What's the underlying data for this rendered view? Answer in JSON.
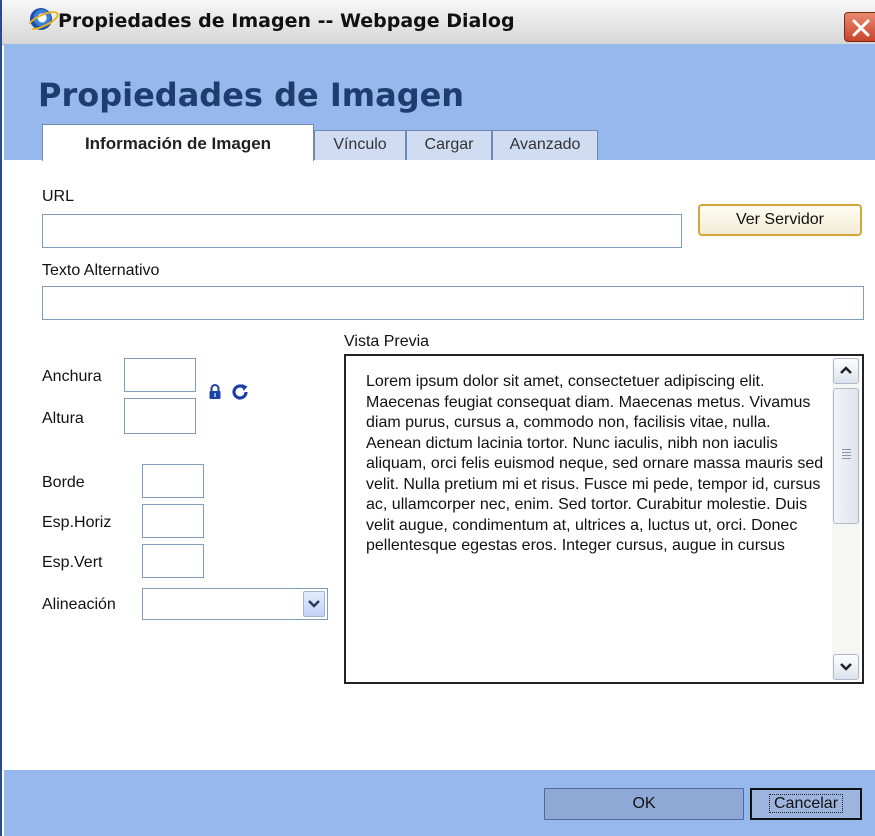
{
  "window": {
    "title": "Propiedades de Imagen -- Webpage Dialog"
  },
  "dialog": {
    "title": "Propiedades de Imagen",
    "tabs": [
      {
        "label": "Información de Imagen",
        "active": true
      },
      {
        "label": "Vínculo",
        "active": false
      },
      {
        "label": "Cargar",
        "active": false
      },
      {
        "label": "Avanzado",
        "active": false
      }
    ]
  },
  "form": {
    "url_label": "URL",
    "url_value": "",
    "browse_button": "Ver Servidor",
    "alt_label": "Texto Alternativo",
    "alt_value": "",
    "width_label": "Anchura",
    "width_value": "",
    "height_label": "Altura",
    "height_value": "",
    "border_label": "Borde",
    "border_value": "",
    "hspace_label": "Esp.Horiz",
    "hspace_value": "",
    "vspace_label": "Esp.Vert",
    "vspace_value": "",
    "align_label": "Alineación",
    "align_value": ""
  },
  "preview": {
    "label": "Vista Previa",
    "text": "Lorem ipsum dolor sit amet, consectetuer adipiscing elit. Maecenas feugiat consequat diam. Maecenas metus. Vivamus diam purus, cursus a, commodo non, facilisis vitae, nulla. Aenean dictum lacinia tortor. Nunc iaculis, nibh non iaculis aliquam, orci felis euismod neque, sed ornare massa mauris sed velit. Nulla pretium mi et risus. Fusce mi pede, tempor id, cursus ac, ullamcorper nec, enim. Sed tortor. Curabitur molestie. Duis velit augue, condimentum at, ultrices a, luctus ut, orci. Donec pellentesque egestas eros. Integer cursus, augue in cursus"
  },
  "footer": {
    "ok_label": "OK",
    "cancel_label": "Cancelar"
  },
  "icons": {
    "app": "ie-icon",
    "close": "close-icon",
    "lock": "lock-icon",
    "reset": "reset-size-icon",
    "dropdown": "chevron-down-icon"
  },
  "colors": {
    "header_bg": "#96b8ec",
    "title_text": "#1f3c6e",
    "close_red": "#c8442a",
    "icon_blue": "#1f3fa8"
  }
}
